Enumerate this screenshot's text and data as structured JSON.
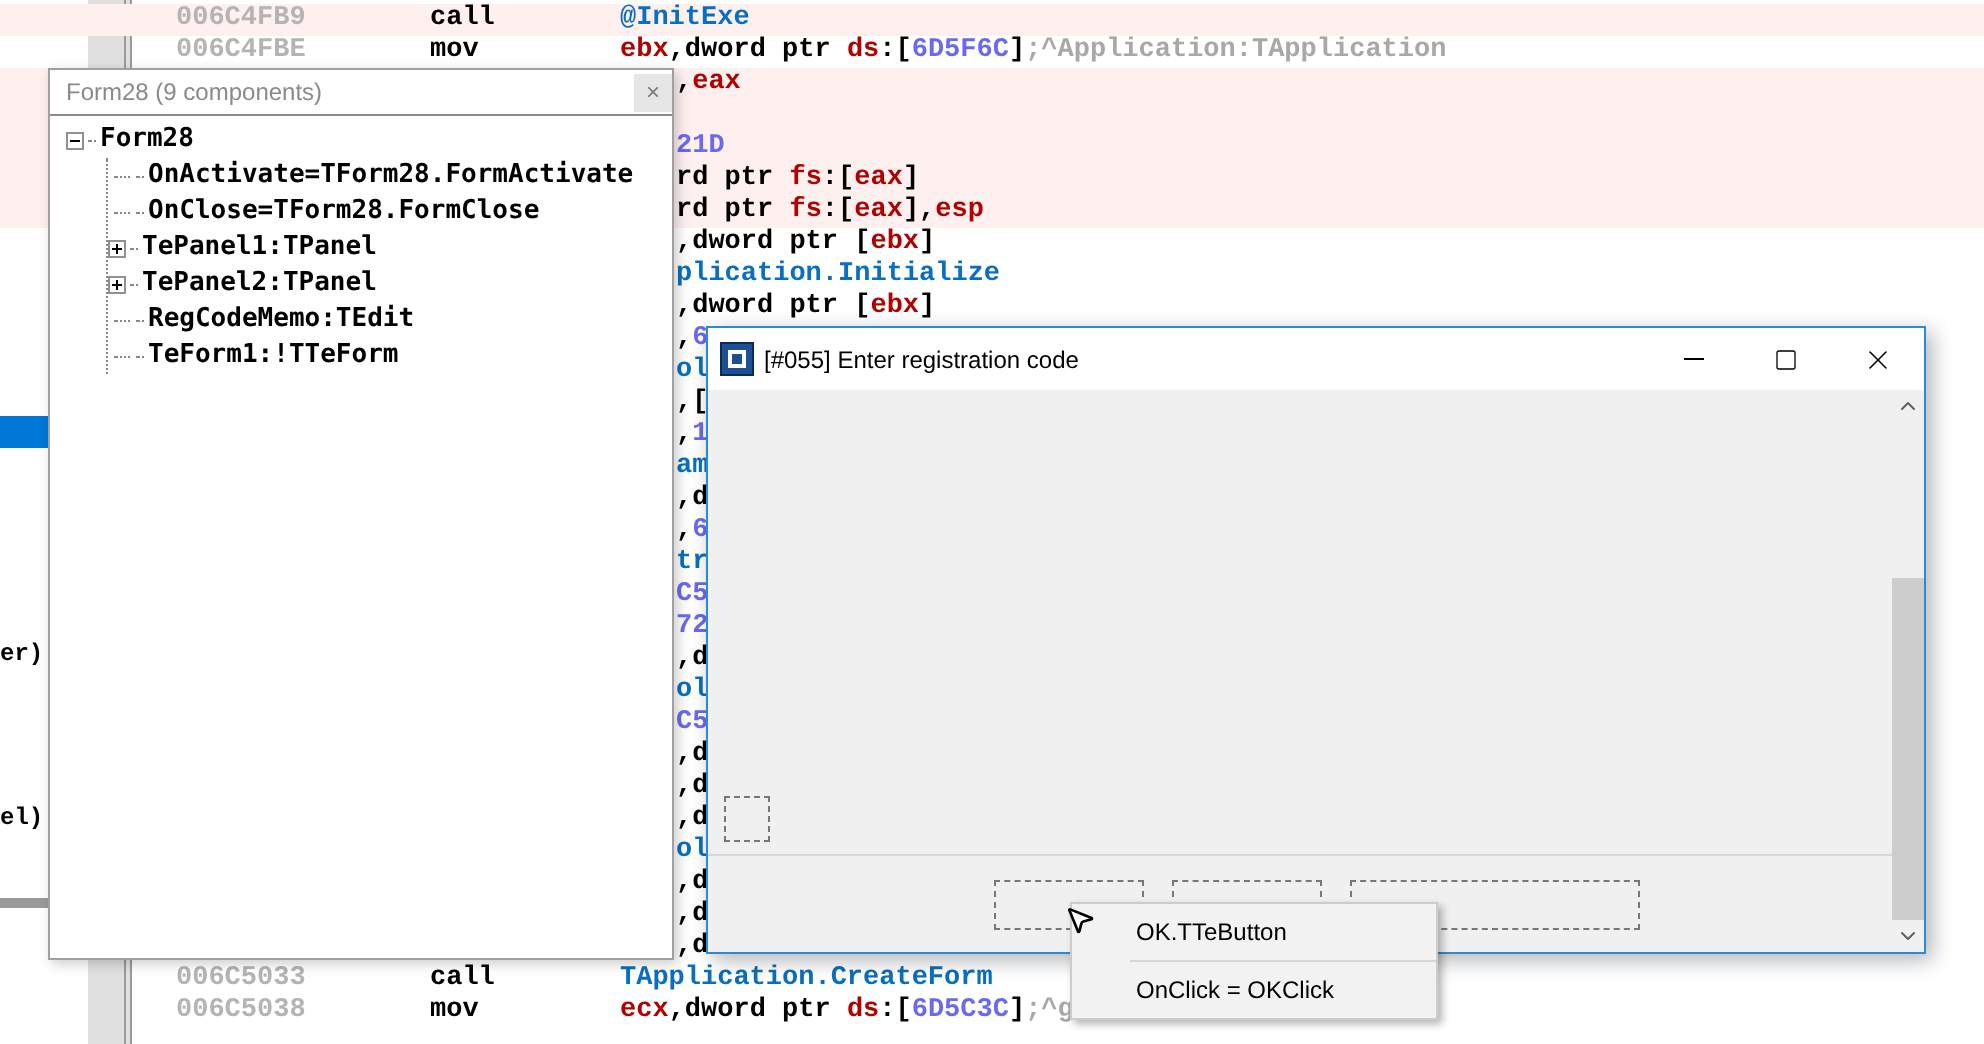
{
  "side_panel": {
    "fragments": [
      {
        "text": "er)"
      },
      {
        "text": "el)"
      }
    ]
  },
  "listing": [
    {
      "address": "006C4FB9",
      "mnemonic": "call",
      "highlight": true,
      "operand": [
        {
          "kind": "sym",
          "text": "@InitExe"
        }
      ]
    },
    {
      "address": "006C4FBE",
      "mnemonic": "mov",
      "highlight": false,
      "operand": [
        {
          "kind": "reg",
          "text": "ebx"
        },
        {
          "kind": "plain",
          "text": ",dword ptr "
        },
        {
          "kind": "reg",
          "text": "ds"
        },
        {
          "kind": "plain",
          "text": ":["
        },
        {
          "kind": "num",
          "text": "6D5F6C"
        },
        {
          "kind": "plain",
          "text": "]"
        },
        {
          "kind": "comment",
          "text": ";^Application:TApplication"
        }
      ]
    },
    {
      "highlight": true,
      "operand": [
        {
          "kind": "plain",
          "text": ","
        },
        {
          "kind": "reg",
          "text": "eax"
        }
      ]
    },
    {
      "highlight": true
    },
    {
      "highlight": true,
      "operand": [
        {
          "kind": "num",
          "text": "21D"
        }
      ]
    },
    {
      "highlight": true,
      "operand": [
        {
          "kind": "plain",
          "text": "rd ptr "
        },
        {
          "kind": "reg",
          "text": "fs"
        },
        {
          "kind": "plain",
          "text": ":["
        },
        {
          "kind": "reg",
          "text": "eax"
        },
        {
          "kind": "plain",
          "text": "]"
        }
      ]
    },
    {
      "highlight": true,
      "operand": [
        {
          "kind": "plain",
          "text": "rd ptr "
        },
        {
          "kind": "reg",
          "text": "fs"
        },
        {
          "kind": "plain",
          "text": ":["
        },
        {
          "kind": "reg",
          "text": "eax"
        },
        {
          "kind": "plain",
          "text": "],"
        },
        {
          "kind": "reg",
          "text": "esp"
        }
      ]
    },
    {
      "highlight": false,
      "operand": [
        {
          "kind": "plain",
          "text": ",dword ptr ["
        },
        {
          "kind": "reg",
          "text": "ebx"
        },
        {
          "kind": "plain",
          "text": "]"
        }
      ]
    },
    {
      "highlight": false,
      "operand": [
        {
          "kind": "sym",
          "text": "plication.Initialize"
        }
      ]
    },
    {
      "highlight": false,
      "operand": [
        {
          "kind": "plain",
          "text": ",dword ptr ["
        },
        {
          "kind": "reg",
          "text": "ebx"
        },
        {
          "kind": "plain",
          "text": "]"
        }
      ]
    },
    {
      "highlight": false,
      "operand": [
        {
          "kind": "plain",
          "text": ","
        },
        {
          "kind": "num",
          "text": "6"
        }
      ]
    },
    {
      "highlight": false,
      "operand": [
        {
          "kind": "sym",
          "text": "ol"
        }
      ]
    },
    {
      "highlight": false,
      "operand": [
        {
          "kind": "plain",
          "text": ",["
        }
      ]
    },
    {
      "highlight": false,
      "operand": [
        {
          "kind": "plain",
          "text": ","
        },
        {
          "kind": "num",
          "text": "1"
        }
      ]
    },
    {
      "highlight": false,
      "operand": [
        {
          "kind": "sym",
          "text": "am"
        }
      ]
    },
    {
      "highlight": false,
      "operand": [
        {
          "kind": "plain",
          "text": ",d"
        }
      ]
    },
    {
      "highlight": false,
      "operand": [
        {
          "kind": "plain",
          "text": ","
        },
        {
          "kind": "num",
          "text": "6"
        }
      ]
    },
    {
      "highlight": false,
      "operand": [
        {
          "kind": "sym",
          "text": "tr"
        }
      ]
    },
    {
      "highlight": false,
      "operand": [
        {
          "kind": "num",
          "text": "C5"
        }
      ]
    },
    {
      "highlight": false,
      "operand": [
        {
          "kind": "num",
          "text": "72"
        }
      ]
    },
    {
      "highlight": false,
      "operand": [
        {
          "kind": "plain",
          "text": ",d"
        }
      ]
    },
    {
      "highlight": false,
      "operand": [
        {
          "kind": "sym",
          "text": "ol"
        }
      ]
    },
    {
      "highlight": false,
      "operand": [
        {
          "kind": "num",
          "text": "C5"
        }
      ]
    },
    {
      "highlight": false,
      "operand": [
        {
          "kind": "plain",
          "text": ",d"
        }
      ]
    },
    {
      "highlight": false,
      "operand": [
        {
          "kind": "plain",
          "text": ",d"
        }
      ]
    },
    {
      "highlight": false,
      "operand": [
        {
          "kind": "plain",
          "text": ",d"
        }
      ]
    },
    {
      "highlight": false,
      "operand": [
        {
          "kind": "sym",
          "text": "ol"
        }
      ]
    },
    {
      "highlight": false,
      "operand": [
        {
          "kind": "plain",
          "text": ",d"
        }
      ]
    },
    {
      "highlight": false,
      "operand": [
        {
          "kind": "plain",
          "text": ",d"
        }
      ]
    },
    {
      "highlight": false,
      "operand": [
        {
          "kind": "plain",
          "text": ",d"
        }
      ]
    },
    {
      "address": "006C5033",
      "mnemonic": "call",
      "highlight": false,
      "operand": [
        {
          "kind": "sym",
          "text": "TApplication.CreateForm"
        }
      ]
    },
    {
      "address": "006C5038",
      "mnemonic": "mov",
      "highlight": false,
      "operand": [
        {
          "kind": "reg",
          "text": "ecx"
        },
        {
          "kind": "plain",
          "text": ",dword ptr "
        },
        {
          "kind": "reg",
          "text": "ds"
        },
        {
          "kind": "plain",
          "text": ":["
        },
        {
          "kind": "num",
          "text": "6D5C3C"
        },
        {
          "kind": "plain",
          "text": "]"
        },
        {
          "kind": "comment",
          "text": ";^g"
        }
      ]
    }
  ],
  "tree_window": {
    "title": "Form28 (9 components)",
    "close": "×",
    "tree": [
      {
        "label": "Form28",
        "expanded": true,
        "children": [
          {
            "label": "OnActivate=TForm28.FormActivate"
          },
          {
            "label": "OnClose=TForm28.FormClose"
          },
          {
            "label": "TePanel1:TPanel",
            "expanded": false
          },
          {
            "label": "TePanel2:TPanel",
            "expanded": false
          },
          {
            "label": "RegCodeMemo:TEdit"
          },
          {
            "label": "TeForm1:!TTeForm"
          }
        ]
      }
    ]
  },
  "form_window": {
    "title": "[#055] Enter registration code"
  },
  "popup_menu": {
    "items": [
      {
        "label": "OK.TTeButton"
      },
      {
        "label": "OnClick = OKClick"
      }
    ]
  }
}
